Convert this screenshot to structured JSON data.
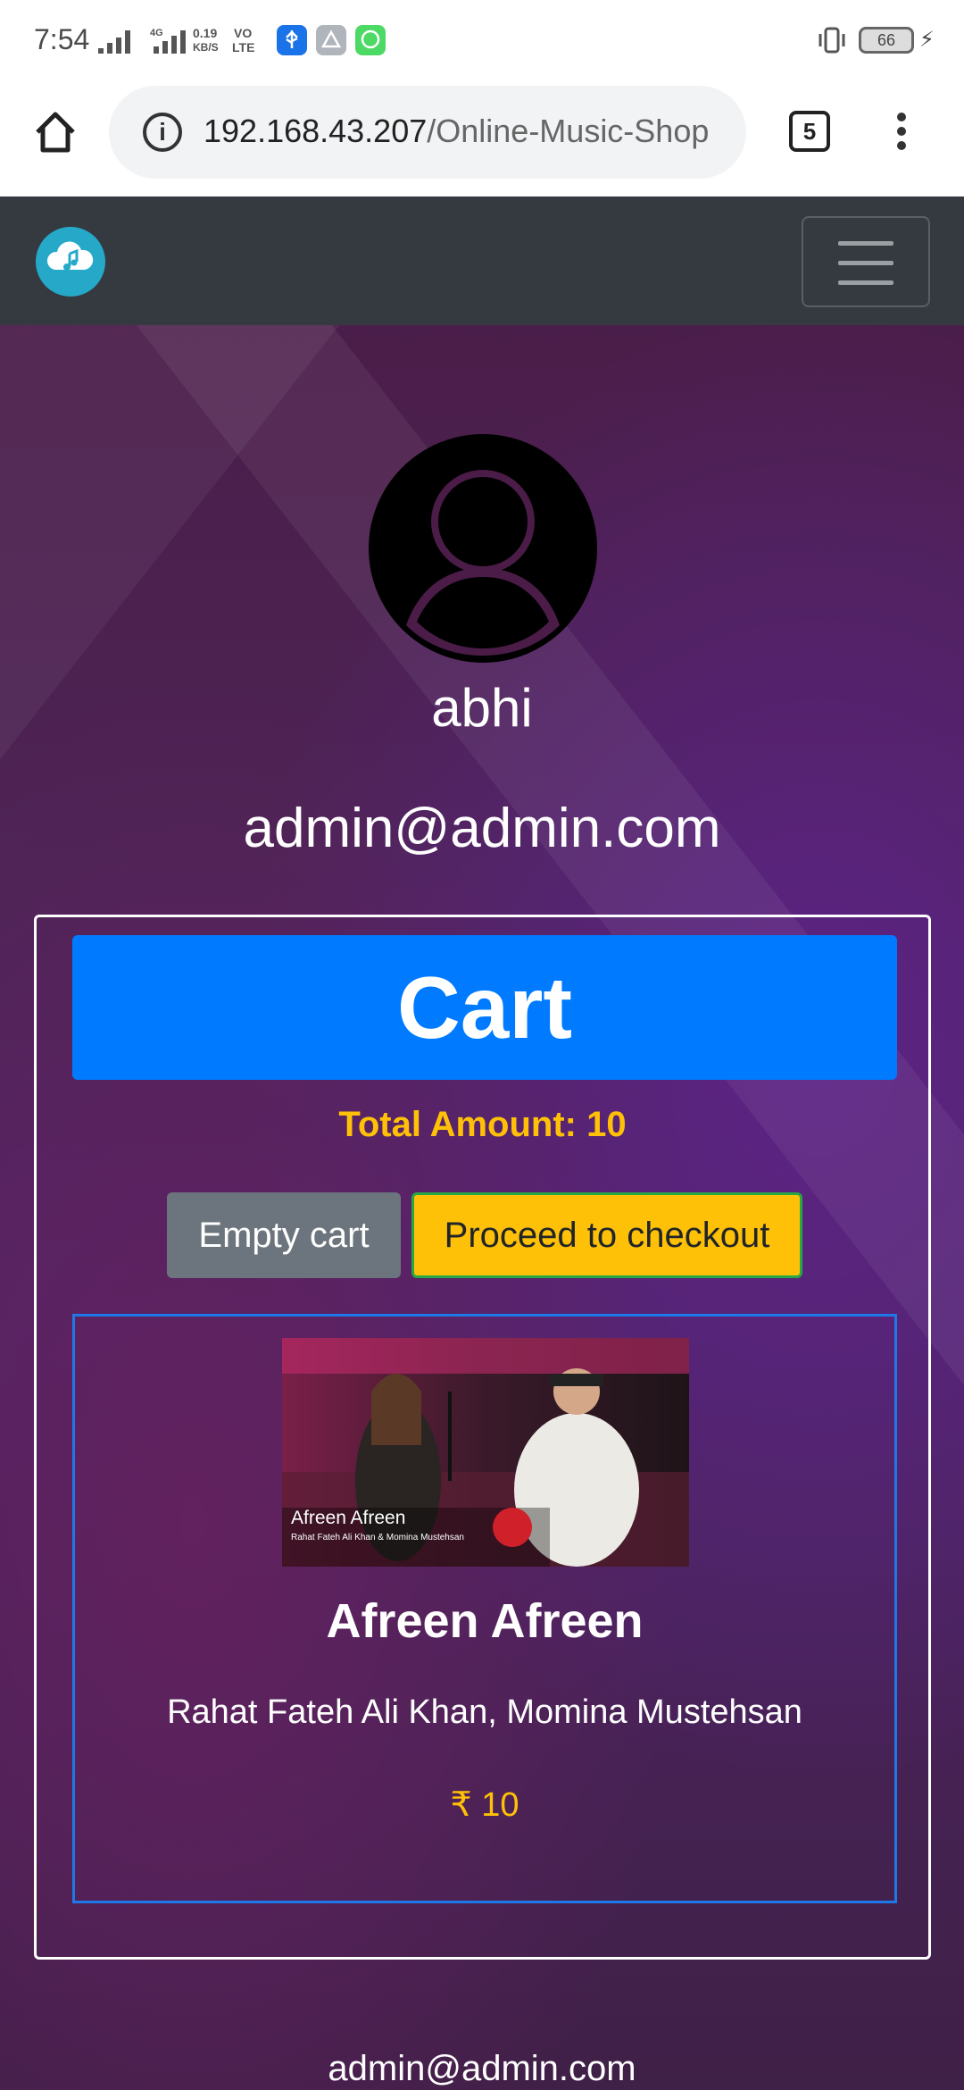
{
  "status_bar": {
    "time": "7:54",
    "net_gen": "4G",
    "speed_value": "0.19",
    "speed_unit": "KB/S",
    "volte_top": "VO",
    "volte_bottom": "LTE",
    "battery": "66"
  },
  "browser": {
    "url_host": "192.168.43.207",
    "url_path": "/Online-Music-Shop",
    "tab_count": "5"
  },
  "profile": {
    "username": "abhi",
    "email": "admin@admin.com"
  },
  "cart": {
    "title": "Cart",
    "total_label": "Total Amount: 10",
    "empty_button": "Empty cart",
    "checkout_button": "Proceed to checkout",
    "items": [
      {
        "title": "Afreen Afreen",
        "artists": "Rahat Fateh Ali Khan, Momina Mustehsan",
        "price": "₹ 10",
        "thumb_caption": "Afreen Afreen",
        "thumb_subcaption": "Rahat Fateh Ali Khan & Momina Mustehsan"
      }
    ]
  },
  "footer": {
    "email": "admin@admin.com"
  },
  "colors": {
    "navbar": "#343a40",
    "primary": "#007bff",
    "warning": "#ffc107",
    "secondary": "#6c757d",
    "logo": "#26a9c9"
  },
  "icons": {
    "home": "home-icon",
    "info": "info-icon",
    "menu": "more-vert-icon",
    "logo": "cloud-music-icon",
    "toggler": "hamburger-icon",
    "avatar": "user-avatar-icon"
  }
}
